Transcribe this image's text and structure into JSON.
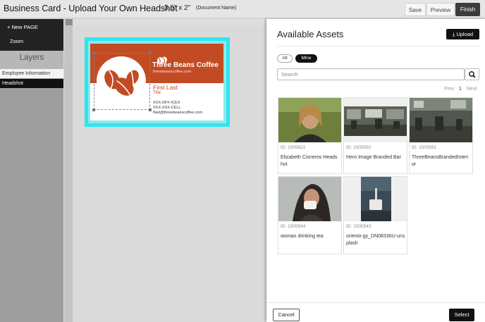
{
  "header": {
    "title": "Business Card - Upload Your Own Headshot",
    "card_size": "3.5\" x 2\"",
    "document_name": "(Document Name)",
    "save_label": "Save",
    "preview_label": "Preview",
    "finish_label": "Finish"
  },
  "left_panel": {
    "new_page_label": "+ New PAGE",
    "zoom_label": "Zoom",
    "layers_heading": "Layers",
    "layers": [
      "Employee Information",
      "Headshot"
    ]
  },
  "card": {
    "brand_name": "Three Beans Coffee",
    "brand_url": "threebeanscoffee.com",
    "person_name": "First Last",
    "person_title": "Title",
    "office_line": "XXX-OFF-ICEX",
    "cell_line": "XXX-XXX-CELL",
    "email_line": "flast@threebeanscoffee.com",
    "colors": {
      "brand_orange": "#c24b23",
      "bleed_cyan": "#2ee6ee"
    }
  },
  "assets_panel": {
    "title": "Available Assets",
    "upload_label": "Upload",
    "filter_all": "All",
    "filter_mine": "Mine",
    "search_placeholder": "Search",
    "pager_prev": "Prev",
    "pager_current": "1",
    "pager_next": "Next",
    "assets": [
      {
        "id": "ID: 1505621",
        "name": "Elizabeth Cisneros Headshot"
      },
      {
        "id": "ID: 1505592",
        "name": "Hero Image Branded Bar"
      },
      {
        "id": "ID: 1505591",
        "name": "ThreeBeansBrandedInterior"
      },
      {
        "id": "ID: 1505544",
        "name": "woman drinking tea"
      },
      {
        "id": "ID: 1505543",
        "name": "oriento-gy_DN08336U-unsplash"
      }
    ],
    "cancel_label": "Cancel",
    "select_label": "Select"
  }
}
